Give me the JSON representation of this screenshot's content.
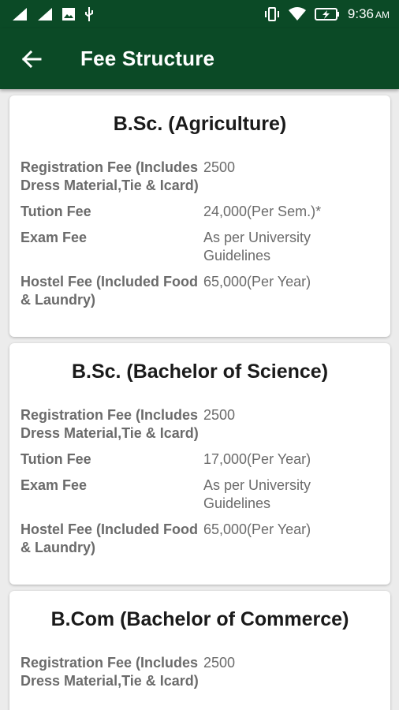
{
  "status_bar": {
    "time": "9:36",
    "ampm": "AM",
    "icons": [
      "signal-1-icon",
      "signal-2-icon",
      "image-icon",
      "usb-icon",
      "vibrate-icon",
      "wifi-icon",
      "battery-charging-icon"
    ]
  },
  "app_bar": {
    "title": "Fee Structure",
    "back_icon": "back-arrow-icon"
  },
  "colors": {
    "primary": "#0b4a26",
    "background": "#ececec",
    "card": "#ffffff",
    "text": "#6b6b6b"
  },
  "courses": [
    {
      "title": "B.Sc. (Agriculture)",
      "fees": [
        {
          "label": "Registration Fee (Includes Dress Material,Tie & Icard)",
          "value": "2500"
        },
        {
          "label": "Tution Fee",
          "value": "24,000(Per Sem.)*"
        },
        {
          "label": "Exam Fee",
          "value": "As per University Guidelines"
        },
        {
          "label": "Hostel Fee (Included Food & Laundry)",
          "value": "65,000(Per Year)"
        }
      ]
    },
    {
      "title": "B.Sc. (Bachelor of Science)",
      "fees": [
        {
          "label": "Registration Fee (Includes Dress Material,Tie & Icard)",
          "value": "2500"
        },
        {
          "label": "Tution Fee",
          "value": "17,000(Per Year)"
        },
        {
          "label": "Exam Fee",
          "value": "As per University Guidelines"
        },
        {
          "label": "Hostel Fee (Included Food & Laundry)",
          "value": "65,000(Per Year)"
        }
      ]
    },
    {
      "title": "B.Com (Bachelor of Commerce)",
      "fees": [
        {
          "label": "Registration Fee (Includes Dress Material,Tie & Icard)",
          "value": "2500"
        }
      ]
    }
  ]
}
